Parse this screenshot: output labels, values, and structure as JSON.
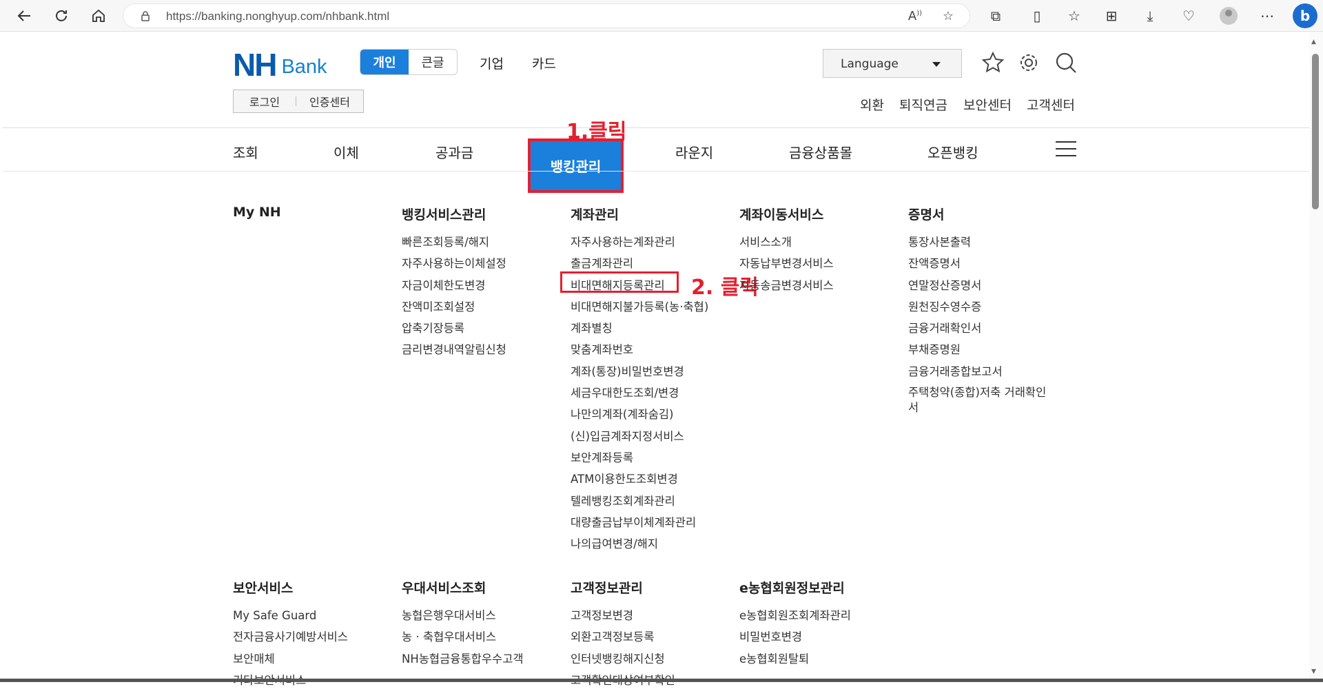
{
  "browser": {
    "url": "https://banking.nonghyup.com/nhbank.html"
  },
  "header": {
    "logo_nh": "NH",
    "logo_bank": "Bank",
    "segment": {
      "active": "개인",
      "inactive": "큰글"
    },
    "top_links": [
      "기업",
      "카드"
    ],
    "language": "Language",
    "login": "로그인",
    "cert": "인증센터",
    "util_links": [
      "외환",
      "퇴직연금",
      "보안센터",
      "고객센터"
    ]
  },
  "gnb": {
    "items": [
      "조회",
      "이체",
      "공과금",
      "뱅킹관리",
      "라운지",
      "금융상품몰",
      "오픈뱅킹"
    ],
    "active": "뱅킹관리"
  },
  "annotations": {
    "step1": "1.클릭",
    "step2": "2. 클릭"
  },
  "menu": {
    "row1": [
      {
        "title": "My NH",
        "items": []
      },
      {
        "title": "뱅킹서비스관리",
        "items": [
          "빠른조회등록/해지",
          "자주사용하는이체설정",
          "자금이체한도변경",
          "잔액미조회설정",
          "압축기장등록",
          "금리변경내역알림신청"
        ]
      },
      {
        "title": "계좌관리",
        "items": [
          "자주사용하는계좌관리",
          "출금계좌관리",
          "비대면해지등록관리",
          "비대면해지불가등록(농·축협)",
          "계좌별칭",
          "맞춤계좌번호",
          "계좌(통장)비밀번호변경",
          "세금우대한도조회/변경",
          "나만의계좌(계좌숨김)",
          "(신)입금계좌지정서비스",
          "보안계좌등록",
          "ATM이용한도조회변경",
          "텔레뱅킹조회계좌관리",
          "대량출금납부이체계좌관리",
          "나의급여변경/해지"
        ]
      },
      {
        "title": "계좌이동서비스",
        "items": [
          "서비스소개",
          "자동납부변경서비스",
          "자동송금변경서비스"
        ]
      },
      {
        "title": "증명서",
        "items": [
          "통장사본출력",
          "잔액증명서",
          "연말정산증명서",
          "원천징수영수증",
          "금융거래확인서",
          "부채증명원",
          "금융거래종합보고서",
          "주택청약(종합)저축 거래확인서"
        ]
      }
    ],
    "row2": [
      {
        "title": "보안서비스",
        "items": [
          "My Safe Guard",
          "전자금융사기예방서비스",
          "보안매체",
          "기타보안서비스"
        ]
      },
      {
        "title": "우대서비스조회",
        "items": [
          "농협은행우대서비스",
          "농 · 축협우대서비스",
          "NH농협금융통합우수고객"
        ]
      },
      {
        "title": "고객정보관리",
        "items": [
          "고객정보변경",
          "외환고객정보등록",
          "인터넷뱅킹해지신청",
          "고객확인대상여부확인"
        ]
      },
      {
        "title": "e농협회원정보관리",
        "items": [
          "e농협회원조회계좌관리",
          "비밀번호변경",
          "e농협회원탈퇴"
        ]
      }
    ]
  }
}
